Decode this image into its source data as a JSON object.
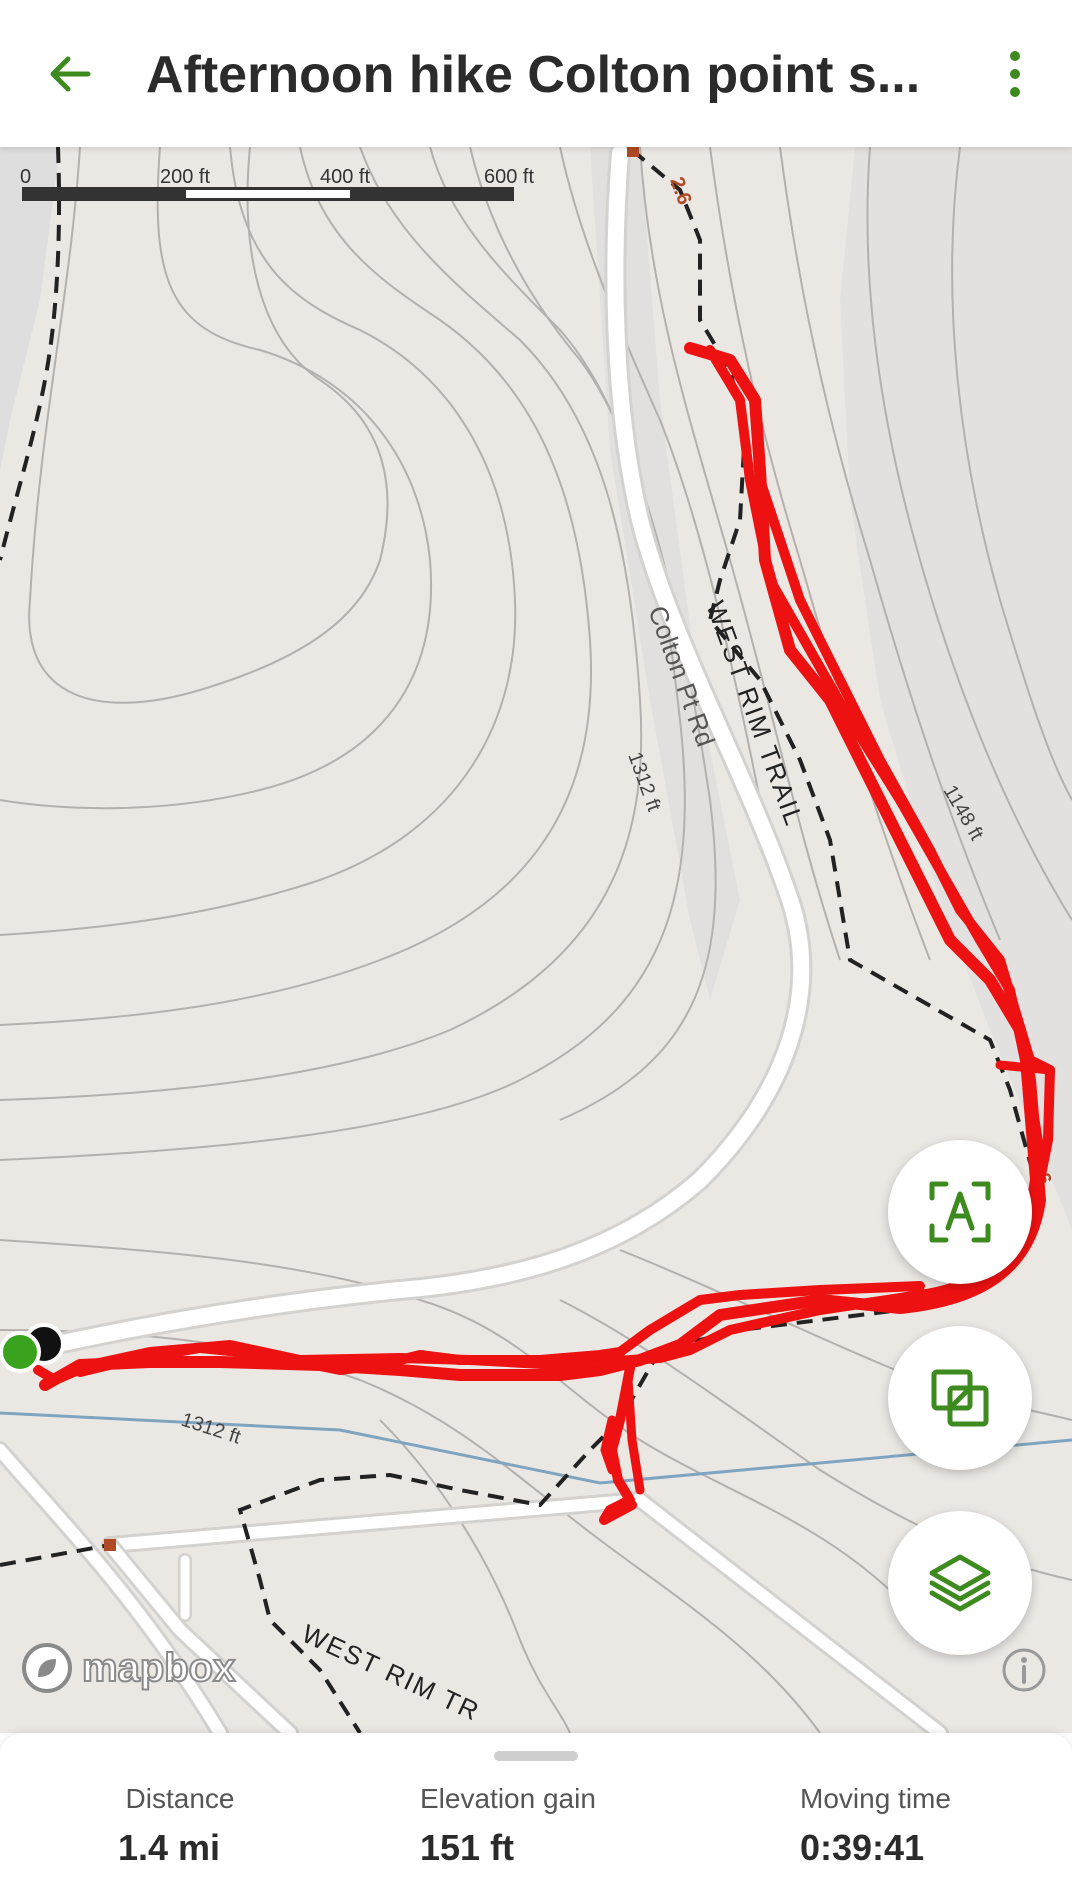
{
  "header": {
    "title": "Afternoon hike Colton point s...",
    "back_icon": "arrow-left-icon",
    "menu_icon": "more-vertical-icon"
  },
  "map": {
    "scale_bar": {
      "labels": [
        "0",
        "200 ft",
        "400 ft",
        "600 ft"
      ]
    },
    "labels": {
      "road": "Colton Pt Rd",
      "trail_1": "WEST RIM TRAIL",
      "trail_2": "WEST RIM TR",
      "contour_1": "1312 ft",
      "contour_2": "1148 ft",
      "contour_3": "1312 ft",
      "trail_marker_1": "2.6",
      "trail_marker_2": "2.6"
    },
    "attribution": "mapbox",
    "buttons": {
      "recenter_icon": "recenter-a-icon",
      "overlay_icon": "overlay-squares-icon",
      "layers_icon": "layers-icon",
      "info_icon": "info-icon"
    }
  },
  "stats": {
    "distance": {
      "label": "Distance",
      "value": "1.4 mi"
    },
    "elevation": {
      "label": "Elevation gain",
      "value": "151 ft"
    },
    "moving_time": {
      "label": "Moving time",
      "value": "0:39:41"
    }
  },
  "colors": {
    "accent": "#3d8a1f",
    "track": "#ee1111",
    "trail": "#222222",
    "road": "#ffffff",
    "water": "#7fa4bf",
    "map_bg": "#ebe8e4",
    "contour": "#aaaaaa"
  }
}
